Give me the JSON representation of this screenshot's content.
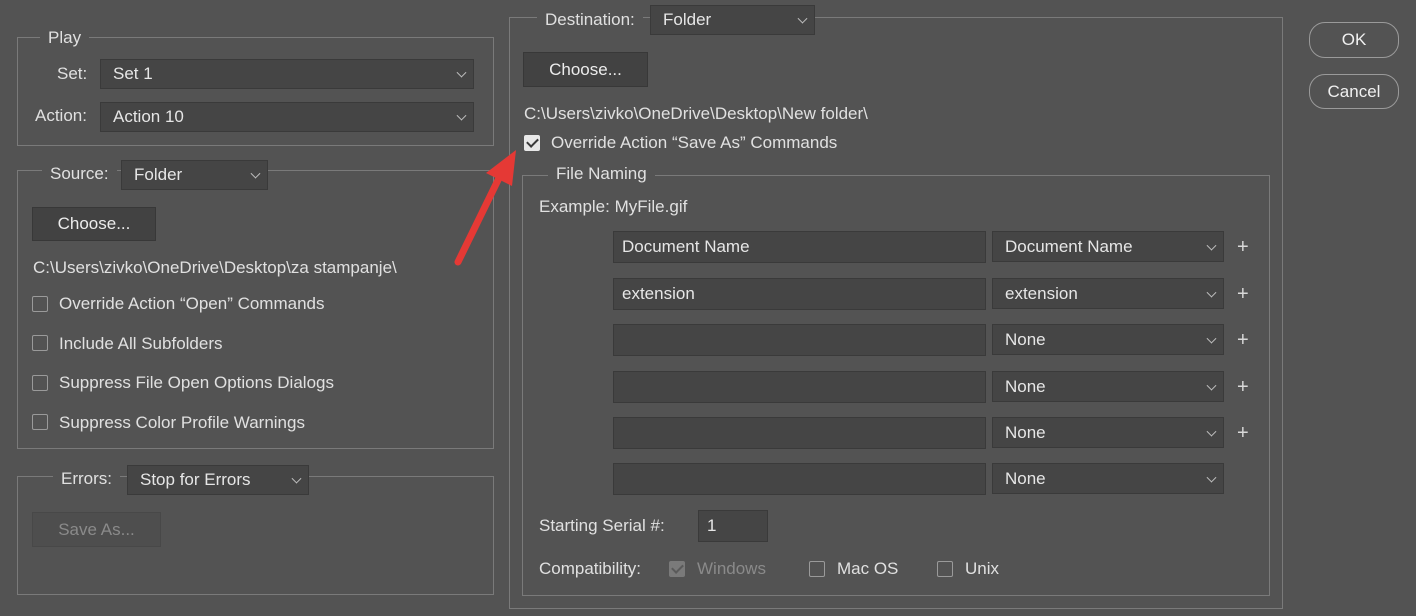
{
  "play": {
    "legend": "Play",
    "set_label": "Set:",
    "set_value": "Set 1",
    "action_label": "Action:",
    "action_value": "Action 10"
  },
  "source": {
    "label": "Source:",
    "value": "Folder",
    "choose_label": "Choose...",
    "path": "C:\\Users\\zivko\\OneDrive\\Desktop\\za stampanje\\",
    "options": [
      {
        "label": "Override Action “Open” Commands",
        "checked": false
      },
      {
        "label": "Include All Subfolders",
        "checked": false
      },
      {
        "label": "Suppress File Open Options Dialogs",
        "checked": false
      },
      {
        "label": "Suppress Color Profile Warnings",
        "checked": false
      }
    ]
  },
  "errors": {
    "label": "Errors:",
    "value": "Stop for Errors",
    "save_as_label": "Save As..."
  },
  "destination": {
    "label": "Destination:",
    "value": "Folder",
    "choose_label": "Choose...",
    "path": "C:\\Users\\zivko\\OneDrive\\Desktop\\New folder\\",
    "override_label": "Override Action “Save As” Commands",
    "override_checked": true
  },
  "file_naming": {
    "legend": "File Naming",
    "example": "Example: MyFile.gif",
    "rows": [
      {
        "text": "Document Name",
        "select": "Document Name"
      },
      {
        "text": "extension",
        "select": "extension"
      },
      {
        "text": "",
        "select": "None"
      },
      {
        "text": "",
        "select": "None"
      },
      {
        "text": "",
        "select": "None"
      },
      {
        "text": "",
        "select": "None"
      }
    ],
    "plus": "+",
    "serial_label": "Starting Serial #:",
    "serial_value": "1",
    "compat_label": "Compatibility:",
    "compat": [
      {
        "label": "Windows",
        "checked": true,
        "disabled": true
      },
      {
        "label": "Mac OS",
        "checked": false,
        "disabled": false
      },
      {
        "label": "Unix",
        "checked": false,
        "disabled": false
      }
    ]
  },
  "buttons": {
    "ok": "OK",
    "cancel": "Cancel"
  },
  "annotation": {
    "arrow_color": "#e53935"
  }
}
